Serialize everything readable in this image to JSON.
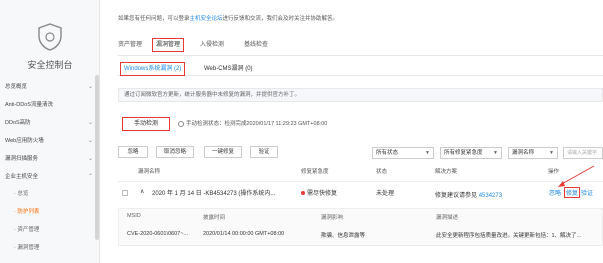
{
  "sidebar": {
    "title": "安全控制台",
    "items": [
      {
        "label": "总览概览"
      },
      {
        "label": "Anti-DDoS流量清洗"
      },
      {
        "label": "DDoS高防"
      },
      {
        "label": "Web应用防火墙"
      },
      {
        "label": "漏洞扫描服务"
      },
      {
        "label": "企业主机安全"
      }
    ],
    "subitems": [
      {
        "label": "总览"
      },
      {
        "label": "防护列表"
      },
      {
        "label": "资产管理"
      },
      {
        "label": "漏洞管理"
      }
    ]
  },
  "notice": {
    "prefix": "如果您有任何问题，可以登录",
    "link": "主机安全论坛",
    "suffix": "进行反馈和交流，我们会及时关注并协助解答。"
  },
  "tabs": [
    {
      "label": "资产管理"
    },
    {
      "label": "漏洞管理"
    },
    {
      "label": "入侵检测"
    },
    {
      "label": "基线检查"
    }
  ],
  "subtabs": [
    {
      "label": "Windows系统漏洞 (2)"
    },
    {
      "label": "Web-CMS漏洞 (0)"
    }
  ],
  "tip": "通过订阅微软官方更新，统计服务器中未修复的漏洞，并提供官方补丁。",
  "check": {
    "button": "手动检测",
    "status": "手动检测状态：检测完成2020/01/17 11:29:23 GMT+08:00"
  },
  "toolbar": {
    "ignore": "忽略",
    "unignore": "取消忽略",
    "fix_all": "一键修复",
    "verify": "验证",
    "status_select": "所有状态",
    "severity_select": "所有修复紧急度",
    "name_select": "漏洞名称",
    "search_placeholder": "请输入关键字"
  },
  "table": {
    "headers": [
      "漏洞名称",
      "修复紧急度",
      "状态",
      "解决方案",
      "操作"
    ],
    "row": {
      "name": "2020 年 1 月 14 日 -KB4534273 (操作系统内...",
      "severity": "需尽快修复",
      "status": "未处理",
      "solution_prefix": "修复建议请参见",
      "solution_link": "4534273",
      "actions": [
        "忽略",
        "修复",
        "验证"
      ]
    }
  },
  "detail": {
    "headers": [
      "MSID",
      "披露时间",
      "漏洞影响",
      "漏洞描述"
    ],
    "row": [
      "CVE-2020-0601\\0607~...",
      "2020/01/14 00:00:00 GMT+08:00",
      "欺骗、信息泄露等",
      "此安全更新程序包括质量改进。关键更新包括：1、解决了..."
    ]
  },
  "colors": {
    "accent_red": "#e53935",
    "link_blue": "#1e88e5",
    "highlight_orange": "#ff6a00"
  }
}
